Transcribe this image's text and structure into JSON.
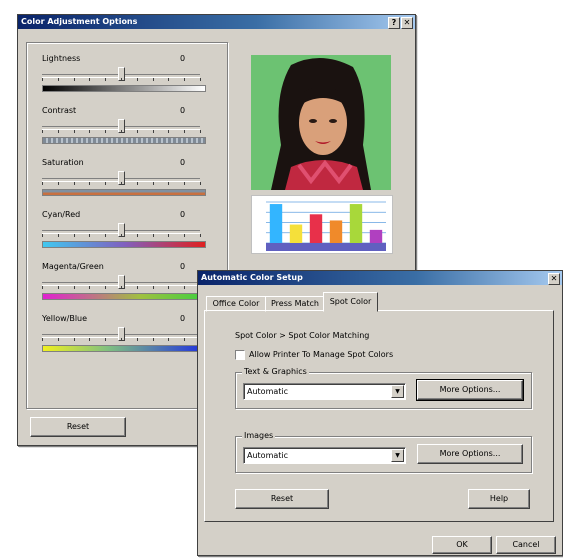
{
  "color_adjustment": {
    "title": "Color Adjustment Options",
    "help_label": "?",
    "close_label": "✕",
    "sliders": [
      {
        "label": "Lightness",
        "value": "0",
        "level": 0.5
      },
      {
        "label": "Contrast",
        "value": "0",
        "level": 0.5
      },
      {
        "label": "Saturation",
        "value": "0",
        "level": 0.5
      },
      {
        "label": "Cyan/Red",
        "value": "0",
        "level": 0.5
      },
      {
        "label": "Magenta/Green",
        "value": "0",
        "level": 0.5
      },
      {
        "label": "Yellow/Blue",
        "value": "0",
        "level": 0.5
      }
    ],
    "reset_label": "Reset",
    "preview_chart": {
      "bar_colors": [
        "#33b5ff",
        "#f5e03a",
        "#e8304a",
        "#f08a2a",
        "#a8d83a",
        "#b040c0"
      ],
      "bar_values": [
        0.95,
        0.45,
        0.7,
        0.55,
        0.95,
        0.32
      ]
    }
  },
  "auto_color": {
    "title": "Automatic Color Setup",
    "close_label": "✕",
    "tabs": [
      "Office Color",
      "Press Match",
      "Spot Color"
    ],
    "active_tab": "Spot Color",
    "heading": "Spot Color > Spot Color Matching",
    "allow_checkbox_label": "Allow Printer To Manage Spot Colors",
    "text_graphics": {
      "group_label": "Text & Graphics",
      "value": "Automatic",
      "more_label": "More Options..."
    },
    "images": {
      "group_label": "Images",
      "value": "Automatic",
      "more_label": "More Options..."
    },
    "reset_label": "Reset",
    "help_label": "Help",
    "ok_label": "OK",
    "cancel_label": "Cancel"
  }
}
